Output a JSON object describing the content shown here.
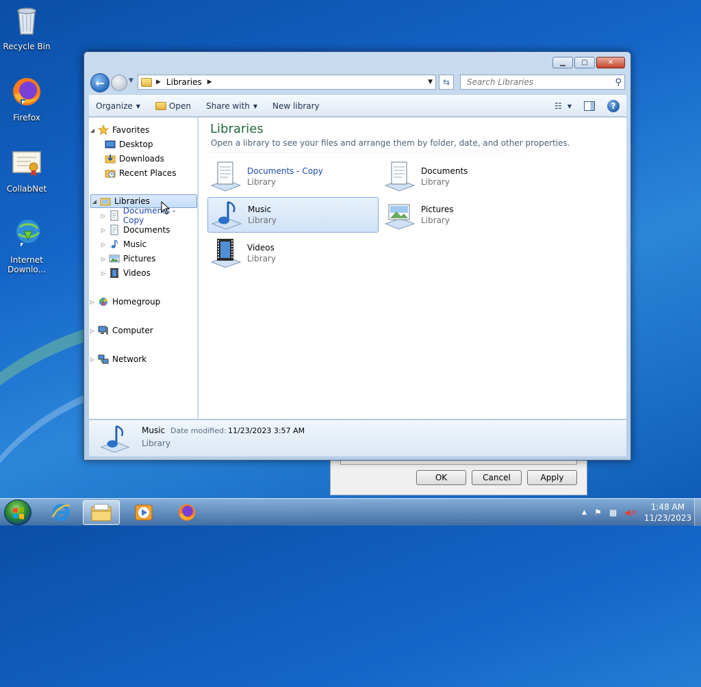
{
  "desktop": {
    "icons": [
      {
        "label": "Recycle Bin",
        "icon": "recycle-bin-icon"
      },
      {
        "label": "Firefox",
        "icon": "firefox-icon"
      },
      {
        "label": "CollabNet",
        "icon": "certificate-icon"
      },
      {
        "label": "Internet Downlo...",
        "icon": "download-manager-icon"
      }
    ]
  },
  "dialog": {
    "ok": "OK",
    "cancel": "Cancel",
    "apply": "Apply"
  },
  "window": {
    "address": {
      "crumb": "Libraries",
      "search_placeholder": "Search Libraries"
    },
    "toolbar": {
      "organize": "Organize",
      "open": "Open",
      "share_with": "Share with",
      "new_library": "New library"
    },
    "nav": {
      "favorites": "Favorites",
      "desktop": "Desktop",
      "downloads": "Downloads",
      "recent_places": "Recent Places",
      "libraries": "Libraries",
      "lib_items": [
        "Documents - Copy",
        "Documents",
        "Music",
        "Pictures",
        "Videos"
      ],
      "homegroup": "Homegroup",
      "computer": "Computer",
      "network": "Network"
    },
    "content": {
      "title": "Libraries",
      "subtitle": "Open a library to see your files and arrange them by folder, date, and other properties.",
      "tiles": [
        {
          "name": "Documents - Copy",
          "type": "Library"
        },
        {
          "name": "Documents",
          "type": "Library"
        },
        {
          "name": "Music",
          "type": "Library"
        },
        {
          "name": "Pictures",
          "type": "Library"
        },
        {
          "name": "Videos",
          "type": "Library"
        }
      ]
    },
    "details": {
      "name": "Music",
      "modified_label": "Date modified:",
      "modified_value": "11/23/2023 3:57 AM",
      "type": "Library"
    }
  },
  "taskbar": {
    "time": "1:48 AM",
    "date": "11/23/2023"
  }
}
